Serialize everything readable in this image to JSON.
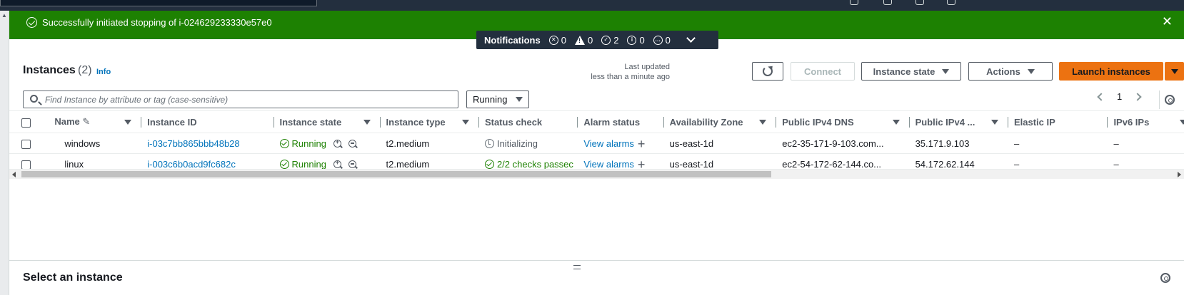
{
  "flash": {
    "message": "Successfully initiated stopping of i-024629233330e57e0"
  },
  "notifications": {
    "label": "Notifications",
    "errors": "0",
    "warnings": "0",
    "success": "2",
    "info": "0",
    "in_progress": "0"
  },
  "header": {
    "title": "Instances",
    "count": "(2)",
    "info": "Info",
    "last_updated_line1": "Last updated",
    "last_updated_line2": "less than a minute ago"
  },
  "toolbar": {
    "connect": "Connect",
    "instance_state": "Instance state",
    "actions": "Actions",
    "launch": "Launch instances"
  },
  "filter": {
    "placeholder": "Find Instance by attribute or tag (case-sensitive)",
    "state_filter": "Running"
  },
  "pagination": {
    "page": "1"
  },
  "table": {
    "columns": [
      "Name",
      "Instance ID",
      "Instance state",
      "Instance type",
      "Status check",
      "Alarm status",
      "Availability Zone",
      "Public IPv4 DNS",
      "Public IPv4 ...",
      "Elastic IP",
      "IPv6 IPs"
    ],
    "rows": [
      {
        "name": "windows",
        "instance_id": "i-03c7bb865bbb48b28",
        "state": "Running",
        "type": "t2.medium",
        "status_check": "Initializing",
        "alarm": "View alarms",
        "az": "us-east-1d",
        "dns": "ec2-35-171-9-103.com...",
        "ipv4": "35.171.9.103",
        "elastic_ip": "–",
        "ipv6": "–"
      },
      {
        "name": "linux",
        "instance_id": "i-003c6b0acd9fc682c",
        "state": "Running",
        "type": "t2.medium",
        "status_check": "2/2 checks passec",
        "alarm": "View alarms",
        "az": "us-east-1d",
        "dns": "ec2-54-172-62-144.co...",
        "ipv4": "54.172.62.144",
        "elastic_ip": "–",
        "ipv6": "–"
      }
    ]
  },
  "lower": {
    "title": "Select an instance"
  }
}
